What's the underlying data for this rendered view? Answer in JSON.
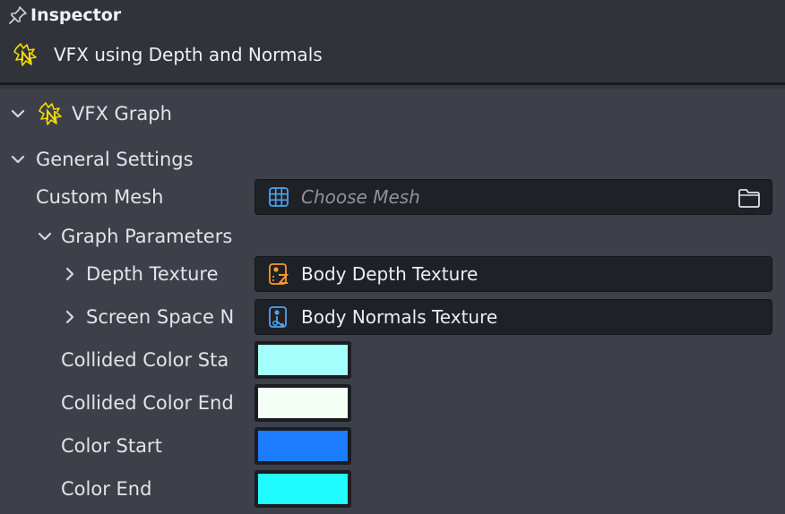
{
  "panel": {
    "title": "Inspector",
    "asset_name": "VFX using Depth and Normals"
  },
  "component": {
    "name": "VFX Graph"
  },
  "general_settings": {
    "label": "General Settings",
    "custom_mesh": {
      "label": "Custom Mesh",
      "placeholder": "Choose Mesh"
    },
    "graph_parameters": {
      "label": "Graph Parameters",
      "depth_texture": {
        "label": "Depth Texture",
        "value": "Body Depth Texture"
      },
      "screen_space_normals": {
        "label": "Screen Space N",
        "value": "Body Normals Texture"
      },
      "collided_color_start": {
        "label": "Collided Color Sta",
        "color": "#a3fefc"
      },
      "collided_color_end": {
        "label": "Collided Color End",
        "color": "#f4fff6"
      },
      "color_start": {
        "label": "Color Start",
        "color": "#1b7cfe"
      },
      "color_end": {
        "label": "Color End",
        "color": "#1ffbff"
      }
    }
  },
  "colors": {
    "accent_yellow": "#f5d90a",
    "accent_orange": "#f59a2c",
    "accent_blue": "#4ea3f0"
  },
  "icons": {
    "pin": "pin-icon",
    "vfx": "vfx-graph-icon",
    "mesh": "mesh-grid-icon",
    "depth_texture": "depth-texture-icon",
    "normals_texture": "normals-texture-icon",
    "folder": "folder-icon",
    "chevron_down": "chevron-down-icon",
    "chevron_right": "chevron-right-icon"
  }
}
